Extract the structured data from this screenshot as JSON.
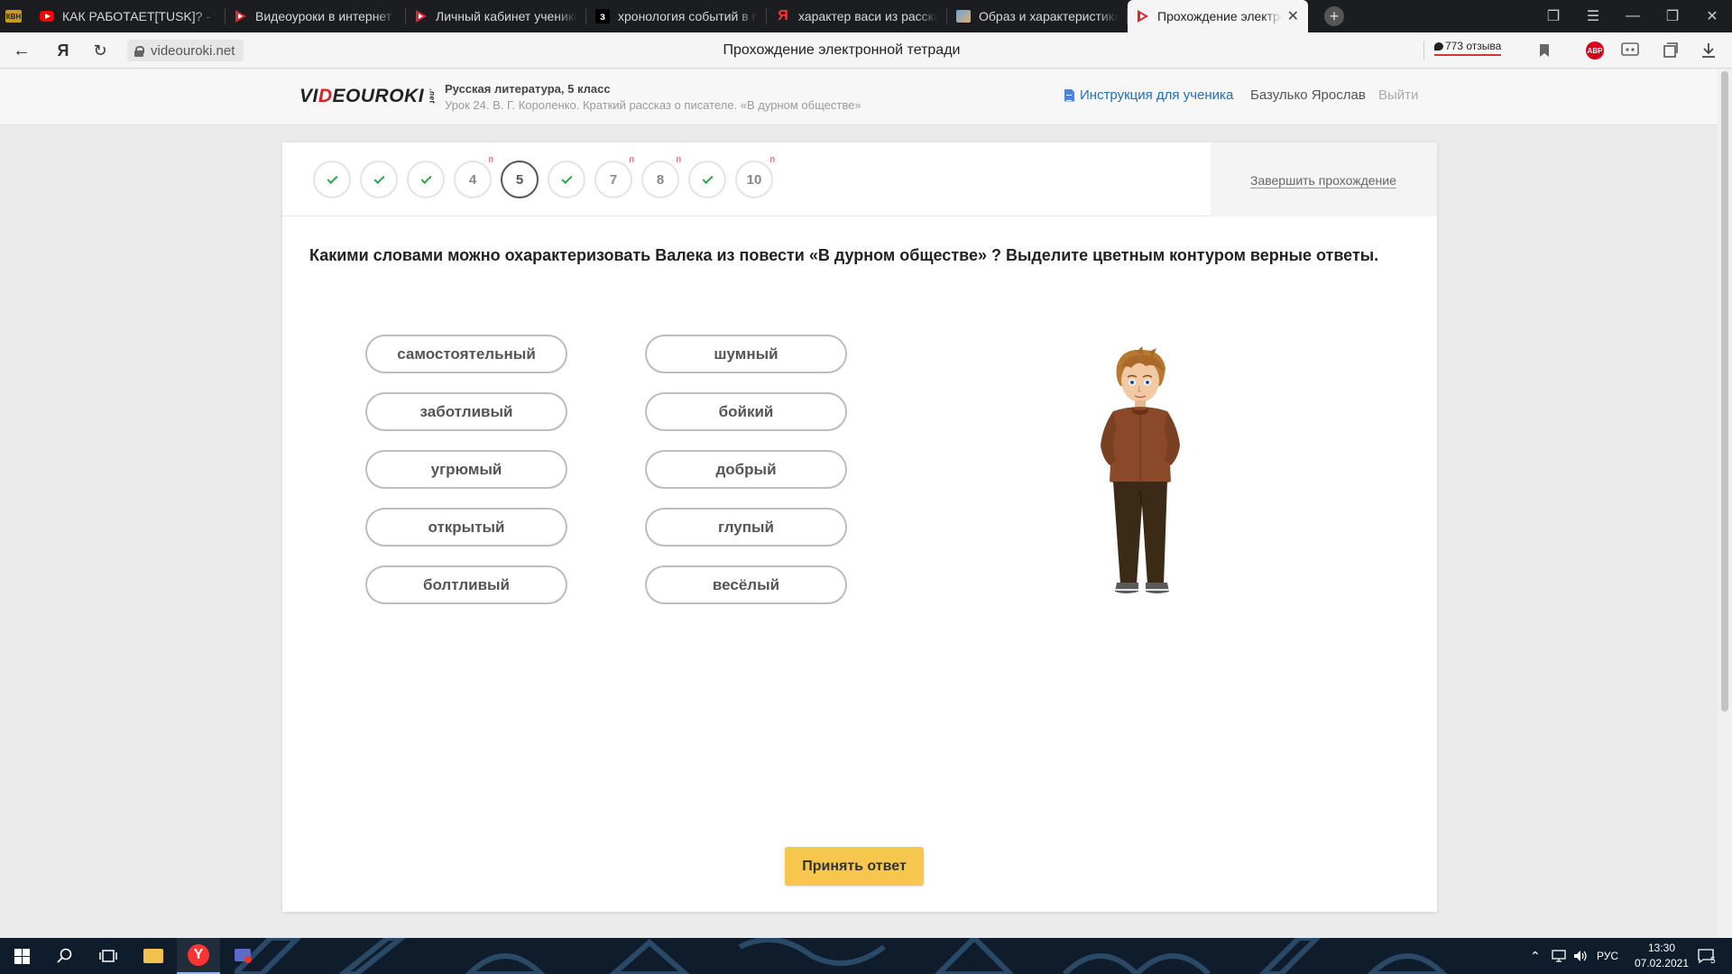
{
  "browser": {
    "tabs": [
      {
        "icon": "kvn-icon",
        "icon_text": "КВН",
        "label": ""
      },
      {
        "icon": "youtube-icon",
        "label": "КАК РАБОТАЕТ[TUSK]? - \\"
      },
      {
        "icon": "videouroki-icon",
        "label": "Видеоуроки в интернет -"
      },
      {
        "icon": "videouroki-icon",
        "label": "Личный кабинет ученика"
      },
      {
        "icon": "znanija-icon",
        "icon_text": "з",
        "label": "хронология событий в пр"
      },
      {
        "icon": "yandex-icon",
        "icon_text": "Я",
        "label": "характер васи из рассказ"
      },
      {
        "icon": "image-icon",
        "label": "Образ и характеристика В"
      },
      {
        "icon": "videouroki-icon",
        "label": "Прохождение электро",
        "active": true
      }
    ],
    "new_tab_label": "+",
    "address": "videouroki.net",
    "page_title": "Прохождение электронной тетради",
    "reviews": "773 отзыва",
    "adblock_label": "ABP"
  },
  "site": {
    "logo_left": "VI",
    "logo_red": "D",
    "logo_right": "EOUROKI",
    "logo_net": ".net",
    "course": "Русская литература, 5 класс",
    "lesson": "Урок 24. В. Г. Короленко. Краткий рассказ о писателе. «В дурном обществе»",
    "instruction_link": "Инструкция для ученика",
    "user_name": "Базулько Ярослав",
    "logout": "Выйти"
  },
  "steps": [
    {
      "label": "",
      "done": true
    },
    {
      "label": "",
      "done": true
    },
    {
      "label": "",
      "done": true
    },
    {
      "label": "4",
      "flag": "п"
    },
    {
      "label": "5",
      "current": true
    },
    {
      "label": "",
      "done": true
    },
    {
      "label": "7",
      "flag": "п"
    },
    {
      "label": "8",
      "flag": "п"
    },
    {
      "label": "",
      "done": true
    },
    {
      "label": "10",
      "flag": "п"
    }
  ],
  "finish_label": "Завершить прохождение",
  "question": "Какими словами можно охарактеризовать Валека из повести «В дурном обществе» ? Выделите цветным контуром верные ответы.",
  "answers": {
    "left": [
      "самостоятельный",
      "заботливый",
      "угрюмый",
      "открытый",
      "болтливый"
    ],
    "right": [
      "шумный",
      "бойкий",
      "добрый",
      "глупый",
      "весёлый"
    ]
  },
  "accept_label": "Принять ответ",
  "taskbar": {
    "lang": "РУС",
    "time": "13:30",
    "date": "07.02.2021",
    "notifications": "5"
  },
  "colors": {
    "accent_blue": "#1e6fb8",
    "brand_red": "#e31e24",
    "check_green": "#2fa14a",
    "accept_yellow": "#f7c74d",
    "flag_red": "#e03232"
  }
}
